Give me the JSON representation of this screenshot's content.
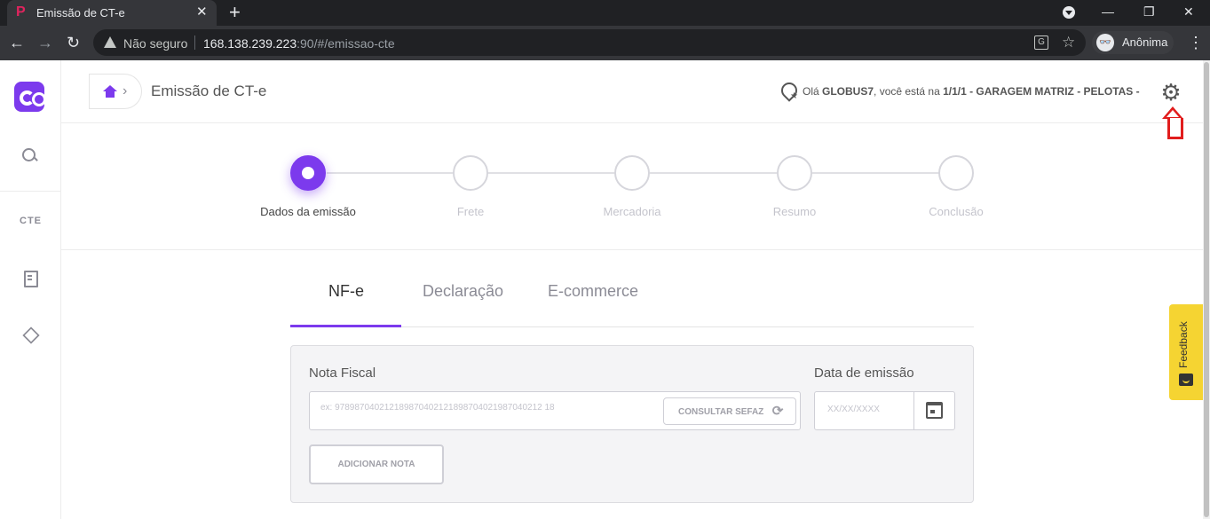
{
  "browser": {
    "tab_title": "Emissão de CT-e",
    "tab_close": "✕",
    "new_tab": "+",
    "security_label": "Não seguro",
    "url_host": "168.138.239.223",
    "url_rest": ":90/#/emissao-cte",
    "profile_label": "Anônima",
    "win_minimize": "—",
    "win_restore": "❐",
    "win_close": "✕",
    "back": "←",
    "forward": "→",
    "reload": "↻",
    "star": "☆",
    "menu": "⋮",
    "translate": "G",
    "incognito_glyph": "👓"
  },
  "sidebar": {
    "logo": "logo-icon",
    "items": [
      {
        "icon": "search-icon"
      },
      {
        "label": "CTE"
      },
      {
        "icon": "receipt-icon"
      },
      {
        "icon": "box-icon"
      }
    ]
  },
  "header": {
    "title": "Emissão de CT-e",
    "greeting_prefix": "Olá ",
    "user": "GLOBUS7",
    "greeting_mid": ", você está na ",
    "location": "1/1/1 - GARAGEM MATRIZ - PELOTAS -",
    "settings_icon": "⚙",
    "breadcrumb_chevron": "›"
  },
  "stepper": {
    "steps": [
      {
        "label": "Dados da emissão",
        "active": true
      },
      {
        "label": "Frete",
        "active": false
      },
      {
        "label": "Mercadoria",
        "active": false
      },
      {
        "label": "Resumo",
        "active": false
      },
      {
        "label": "Conclusão",
        "active": false
      }
    ]
  },
  "tabs": [
    {
      "label": "NF-e",
      "active": true
    },
    {
      "label": "Declaração",
      "active": false
    },
    {
      "label": "E-commerce",
      "active": false
    }
  ],
  "form": {
    "nota_fiscal_label": "Nota Fiscal",
    "nota_fiscal_placeholder": "ex: 978987040212189870402121898704021987040212 18",
    "consultar_label": "CONSULTAR SEFAZ",
    "refresh_icon": "⟳",
    "data_emissao_label": "Data de emissão",
    "data_placeholder": "XX/XX/XXXX",
    "adicionar_label": "ADICIONAR NOTA"
  },
  "feedback": {
    "label": "Feedback",
    "accent": "#f5d432"
  },
  "colors": {
    "accent": "#7c3aed",
    "alert": "#e11d1d"
  }
}
